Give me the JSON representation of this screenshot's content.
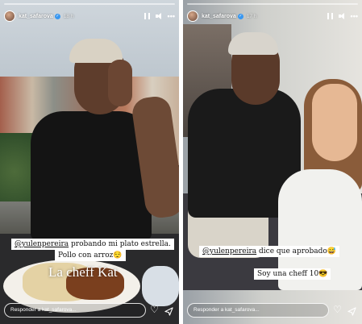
{
  "stories": [
    {
      "username": "kat_safarova",
      "time": "18 h",
      "caption_line1_mention": "@yulenpereira",
      "caption_line1_rest": " probando mi plato estrella.",
      "caption_line2": "Pollo con arroz😌",
      "big_text": "La cheff Kat",
      "reply_placeholder": "Responder a kat_safarova..."
    },
    {
      "username": "kat_safarova",
      "time": "17 h",
      "caption_line1_mention": "@yulenpereira",
      "caption_line1_rest": " dice que aprobado😅",
      "caption_line2": "Soy una cheff 10😎",
      "reply_placeholder": "Responder a kat_safarova..."
    }
  ],
  "icons": {
    "verified": "verified-badge-icon",
    "pause": "pause-icon",
    "mute": "mute-icon",
    "more": "more-icon",
    "heart": "heart-icon",
    "send": "send-icon"
  },
  "glyphs": {
    "verified": "✓",
    "more": "•••",
    "heart": "♡"
  },
  "colors": {
    "verified": "#3897f0",
    "caption_bg": "#ffffff"
  }
}
